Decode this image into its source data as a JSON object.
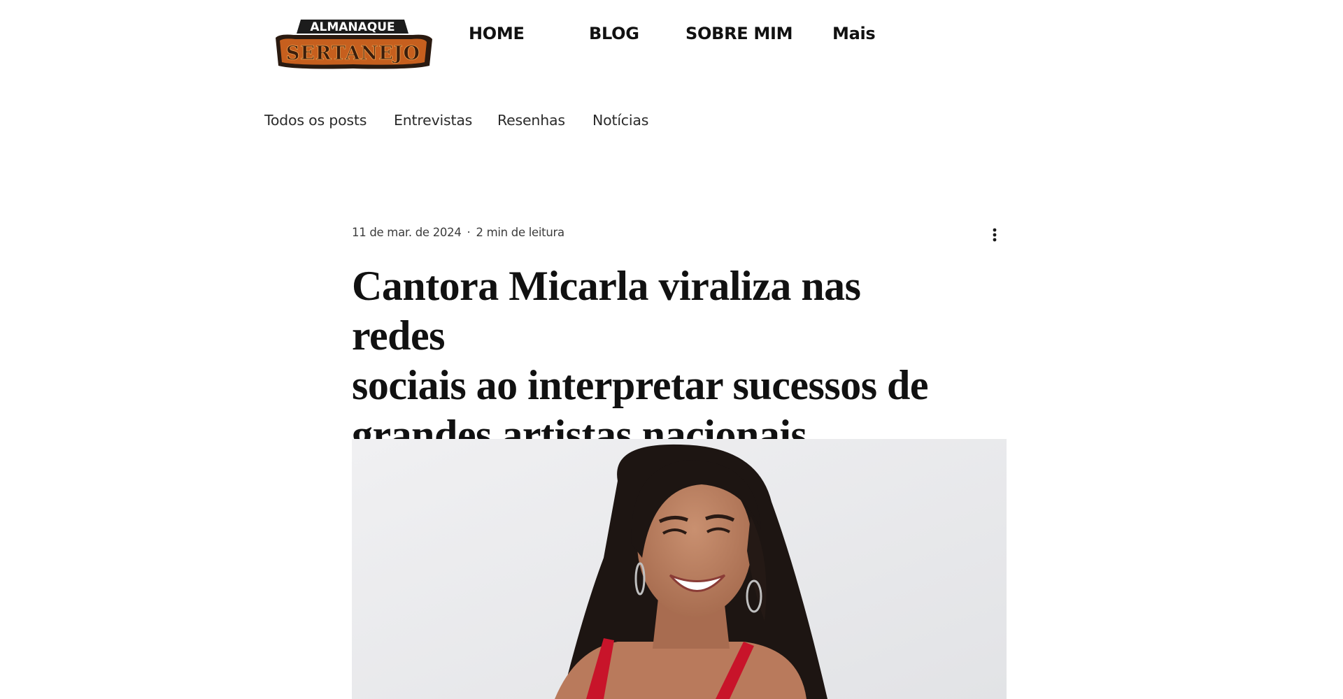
{
  "site": {
    "logo": {
      "line1": "ALMANAQUE",
      "line2": "SERTANEJO"
    }
  },
  "main_nav": {
    "items": [
      {
        "label": "HOME"
      },
      {
        "label": "BLOG"
      },
      {
        "label": "SOBRE MIM"
      },
      {
        "label": "Mais"
      }
    ]
  },
  "categories": {
    "items": [
      {
        "label": "Todos os posts"
      },
      {
        "label": "Entrevistas"
      },
      {
        "label": "Resenhas"
      },
      {
        "label": "Notícias"
      }
    ]
  },
  "post": {
    "date": "11 de mar. de 2024",
    "separator": "·",
    "read_time": "2 min de leitura",
    "more_icon": "more-vertical-icon",
    "title_lines": [
      "Cantora Micarla viraliza nas redes",
      "sociais ao interpretar sucessos de",
      "grandes artistas nacionais"
    ],
    "hero_image": "photo-of-smiling-woman-red-dress"
  },
  "colors": {
    "text": "#111111",
    "logo_orange": "#d2691e",
    "logo_dark": "#2a1a10",
    "hero_bg": "#ececec",
    "dress_red": "#c8142a"
  }
}
